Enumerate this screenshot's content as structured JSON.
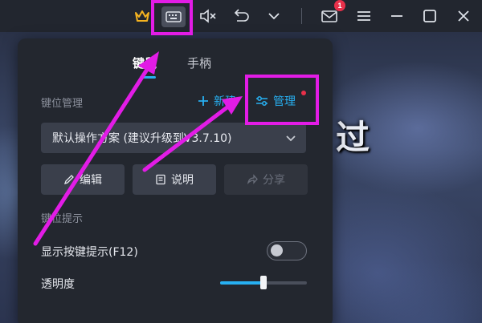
{
  "background": {
    "title_glyph": "过"
  },
  "titlebar": {
    "notification_count": "1"
  },
  "panel": {
    "tabs": [
      {
        "label": "键鼠",
        "active": true
      },
      {
        "label": "手柄",
        "active": false
      }
    ],
    "keymap_section_label": "键位管理",
    "new_label": "新建",
    "manage_label": "管理",
    "selected_scheme": "默认操作方案 (建议升级到V3.7.10)",
    "buttons": {
      "edit_label": "编辑",
      "info_label": "说明",
      "share_label": "分享"
    },
    "hint_section_label": "键位提示",
    "show_hint_label": "显示按键提示(F12)",
    "show_hint_enabled": false,
    "opacity_label": "透明度",
    "opacity_value": 0.5
  },
  "colors": {
    "accent": "#27b0f2",
    "annotation": "#e21ce6",
    "badge": "#e8304a",
    "crown": "#f5b320"
  },
  "icons": [
    "crown-icon",
    "keyboard-icon",
    "mute-icon",
    "undo-icon",
    "chevron-down-icon",
    "mail-icon",
    "menu-icon",
    "maximize-icon",
    "close-icon",
    "plus-icon",
    "sliders-icon",
    "pencil-icon",
    "document-icon",
    "share-icon"
  ]
}
